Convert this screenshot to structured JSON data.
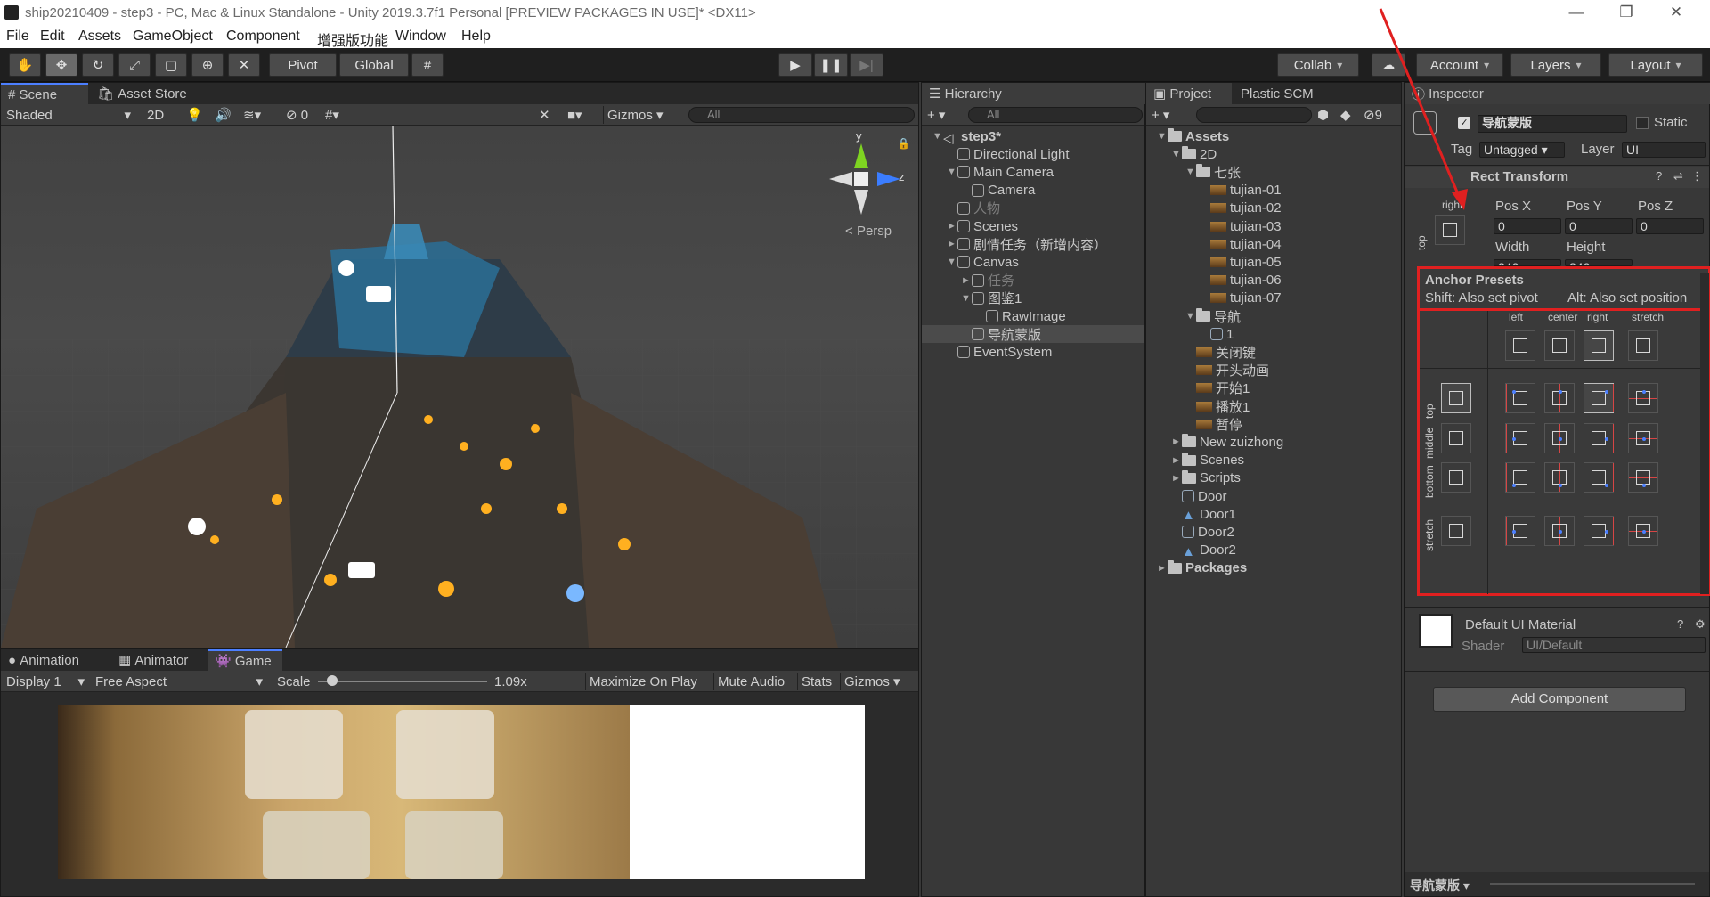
{
  "window": {
    "title": "ship20210409 - step3 - PC, Mac & Linux Standalone - Unity 2019.3.7f1 Personal [PREVIEW PACKAGES IN USE]* <DX11>",
    "minimize": "—",
    "restore": "❐",
    "close": "✕"
  },
  "menu": [
    "File",
    "Edit",
    "Assets",
    "GameObject",
    "Component",
    "增强版功能",
    "Window",
    "Help"
  ],
  "toolbar": {
    "pivot": "Pivot",
    "global": "Global",
    "collab": "Collab",
    "account": "Account",
    "layers": "Layers",
    "layout": "Layout"
  },
  "scene": {
    "tab": "Scene",
    "tab2": "Asset Store",
    "shading": "Shaded",
    "mode2d": "2D",
    "fx_count": "0",
    "gizmos": "Gizmos",
    "search_placeholder": "All",
    "persp": "Persp",
    "axis_y": "y",
    "axis_z": "z"
  },
  "game": {
    "tabs": [
      "Animation",
      "Animator",
      "Game"
    ],
    "display": "Display 1",
    "aspect": "Free Aspect",
    "scale_label": "Scale",
    "scale_value": "1.09x",
    "maximize": "Maximize On Play",
    "mute": "Mute Audio",
    "stats": "Stats",
    "gizmos": "Gizmos",
    "scale_fraction": 0.05
  },
  "hierarchy": {
    "tab": "Hierarchy",
    "search_placeholder": "All",
    "items": [
      {
        "label": "step3*",
        "depth": 0,
        "expand": "▼",
        "icon": "unity-scene-icon",
        "bold": true
      },
      {
        "label": "Directional Light",
        "depth": 1,
        "expand": "",
        "icon": "cube-icon"
      },
      {
        "label": "Main Camera",
        "depth": 1,
        "expand": "▼",
        "icon": "cube-icon"
      },
      {
        "label": "Camera",
        "depth": 2,
        "expand": "",
        "icon": "cube-icon"
      },
      {
        "label": "人物",
        "depth": 1,
        "expand": "",
        "icon": "cube-icon",
        "dim": true
      },
      {
        "label": "Scenes",
        "depth": 1,
        "expand": "►",
        "icon": "cube-icon"
      },
      {
        "label": "剧情任务（新增内容）",
        "depth": 1,
        "expand": "►",
        "icon": "cube-icon"
      },
      {
        "label": "Canvas",
        "depth": 1,
        "expand": "▼",
        "icon": "cube-icon"
      },
      {
        "label": "任务",
        "depth": 2,
        "expand": "►",
        "icon": "cube-icon",
        "dim": true
      },
      {
        "label": "图鉴1",
        "depth": 2,
        "expand": "▼",
        "icon": "cube-icon"
      },
      {
        "label": "RawImage",
        "depth": 3,
        "expand": "",
        "icon": "cube-icon"
      },
      {
        "label": "导航蒙版",
        "depth": 2,
        "expand": "",
        "icon": "cube-icon",
        "selected": true
      },
      {
        "label": "EventSystem",
        "depth": 1,
        "expand": "",
        "icon": "cube-icon"
      }
    ]
  },
  "project": {
    "tab": "Project",
    "tab2": "Plastic SCM",
    "hidden_count": "9",
    "items": [
      {
        "label": "Assets",
        "depth": 0,
        "expand": "▼",
        "icon": "folder-icon",
        "bold": true
      },
      {
        "label": "2D",
        "depth": 1,
        "expand": "▼",
        "icon": "folder-icon"
      },
      {
        "label": "七张",
        "depth": 2,
        "expand": "▼",
        "icon": "folder-icon"
      },
      {
        "label": "tujian-01",
        "depth": 3,
        "expand": "",
        "icon": "texture-icon"
      },
      {
        "label": "tujian-02",
        "depth": 3,
        "expand": "",
        "icon": "texture-icon"
      },
      {
        "label": "tujian-03",
        "depth": 3,
        "expand": "",
        "icon": "texture-icon"
      },
      {
        "label": "tujian-04",
        "depth": 3,
        "expand": "",
        "icon": "texture-icon"
      },
      {
        "label": "tujian-05",
        "depth": 3,
        "expand": "",
        "icon": "texture-icon"
      },
      {
        "label": "tujian-06",
        "depth": 3,
        "expand": "",
        "icon": "texture-icon"
      },
      {
        "label": "tujian-07",
        "depth": 3,
        "expand": "",
        "icon": "texture-icon"
      },
      {
        "label": "导航",
        "depth": 2,
        "expand": "▼",
        "icon": "folder-icon"
      },
      {
        "label": "1",
        "depth": 3,
        "expand": "",
        "icon": "prefab-icon"
      },
      {
        "label": "关闭键",
        "depth": 2,
        "expand": "",
        "icon": "texture-icon"
      },
      {
        "label": "开头动画",
        "depth": 2,
        "expand": "",
        "icon": "texture-icon"
      },
      {
        "label": "开始1",
        "depth": 2,
        "expand": "",
        "icon": "texture-icon"
      },
      {
        "label": "播放1",
        "depth": 2,
        "expand": "",
        "icon": "texture-icon"
      },
      {
        "label": "暂停",
        "depth": 2,
        "expand": "",
        "icon": "texture-icon"
      },
      {
        "label": "New zuizhong",
        "depth": 1,
        "expand": "►",
        "icon": "folder-icon"
      },
      {
        "label": "Scenes",
        "depth": 1,
        "expand": "►",
        "icon": "folder-icon"
      },
      {
        "label": "Scripts",
        "depth": 1,
        "expand": "►",
        "icon": "folder-icon"
      },
      {
        "label": "Door",
        "depth": 1,
        "expand": "",
        "icon": "prefab-icon"
      },
      {
        "label": "Door1",
        "depth": 1,
        "expand": "",
        "icon": "model-icon"
      },
      {
        "label": "Door2",
        "depth": 1,
        "expand": "",
        "icon": "prefab-icon"
      },
      {
        "label": "Door2",
        "depth": 1,
        "expand": "",
        "icon": "model-icon"
      },
      {
        "label": "Packages",
        "depth": 0,
        "expand": "►",
        "icon": "folder-icon",
        "bold": true
      }
    ]
  },
  "inspector": {
    "tab": "Inspector",
    "object_name": "导航蒙版",
    "static_label": "Static",
    "tag_label": "Tag",
    "tag_value": "Untagged",
    "layer_label": "Layer",
    "layer_value": "UI",
    "rect_transform": "Rect Transform",
    "anchor_h": "right",
    "anchor_v": "top",
    "posx_label": "Pos X",
    "posy_label": "Pos Y",
    "posz_label": "Pos Z",
    "posx": "0",
    "posy": "0",
    "posz": "0",
    "width_label": "Width",
    "height_label": "Height",
    "width": "240",
    "height": "240",
    "presets_title": "Anchor Presets",
    "presets_hint_shift": "Shift: Also set pivot",
    "presets_hint_alt": "Alt: Also set position",
    "col_labels": [
      "left",
      "center",
      "right",
      "stretch"
    ],
    "row_labels": [
      "top",
      "middle",
      "bottom",
      "stretch"
    ],
    "material_name": "Default UI Material",
    "shader_label": "Shader",
    "shader_value": "UI/Default",
    "add_component": "Add Component",
    "footer_label": "导航蒙版"
  },
  "colors": {
    "accent": "#4c7fff",
    "highlight_red": "#e02020"
  }
}
